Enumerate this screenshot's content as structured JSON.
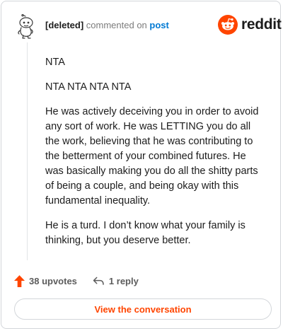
{
  "header": {
    "username": "[deleted]",
    "action_text": "commented on",
    "target_link": "post"
  },
  "brand": {
    "wordmark": "reddit",
    "icon": "reddit-snoo-icon",
    "accent_color": "#ff4500"
  },
  "avatar": {
    "icon": "deleted-user-avatar-icon"
  },
  "comment": {
    "paragraphs": [
      "NTA",
      "NTA NTA NTA NTA",
      "He was actively deceiving you in order to avoid any sort of work. He was LETTING you do all the work, believing that he was contributing to the betterment of your combined futures. He was basically making you do all the shitty parts of being a couple, and being okay with this fundamental inequality.",
      "He is a turd. I don’t know what your family is thinking, but you deserve better."
    ]
  },
  "footer": {
    "upvotes_label": "38 upvotes",
    "upvote_icon": "upvote-arrow-icon",
    "replies_label": "1 reply",
    "reply_icon": "reply-arrow-icon"
  },
  "cta": {
    "label": "View the conversation"
  }
}
